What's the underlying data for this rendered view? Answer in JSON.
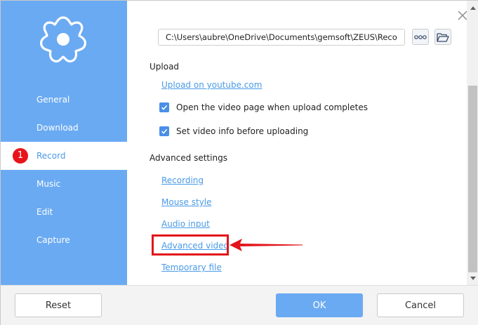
{
  "sidebar": {
    "items": [
      {
        "label": "General",
        "active": false
      },
      {
        "label": "Download",
        "active": false
      },
      {
        "label": "Record",
        "active": true,
        "badge": "1"
      },
      {
        "label": "Music",
        "active": false
      },
      {
        "label": "Edit",
        "active": false
      },
      {
        "label": "Capture",
        "active": false
      }
    ],
    "logo_icon": "flower-gear-icon"
  },
  "content": {
    "path_value": "C:\\Users\\aubre\\OneDrive\\Documents\\gemsoft\\ZEUS\\Recordi",
    "upload": {
      "title": "Upload",
      "youtube_link": "Upload on youtube.com",
      "checkbox_open_page": {
        "label": "Open the video page when upload completes",
        "checked": true
      },
      "checkbox_video_info": {
        "label": "Set video info before uploading",
        "checked": true
      }
    },
    "advanced": {
      "title": "Advanced settings",
      "links": {
        "recording": "Recording",
        "mouse_style": "Mouse style",
        "audio_input": "Audio input",
        "advanced_video": "Advanced video",
        "temporary_file": "Temporary file"
      }
    }
  },
  "footer": {
    "reset_label": "Reset",
    "ok_label": "OK",
    "cancel_label": "Cancel"
  },
  "colors": {
    "sidebar": "#6aaaf2",
    "link": "#4a9ae6",
    "annotation": "#e2141b",
    "checkbox": "#4a8fe8"
  }
}
